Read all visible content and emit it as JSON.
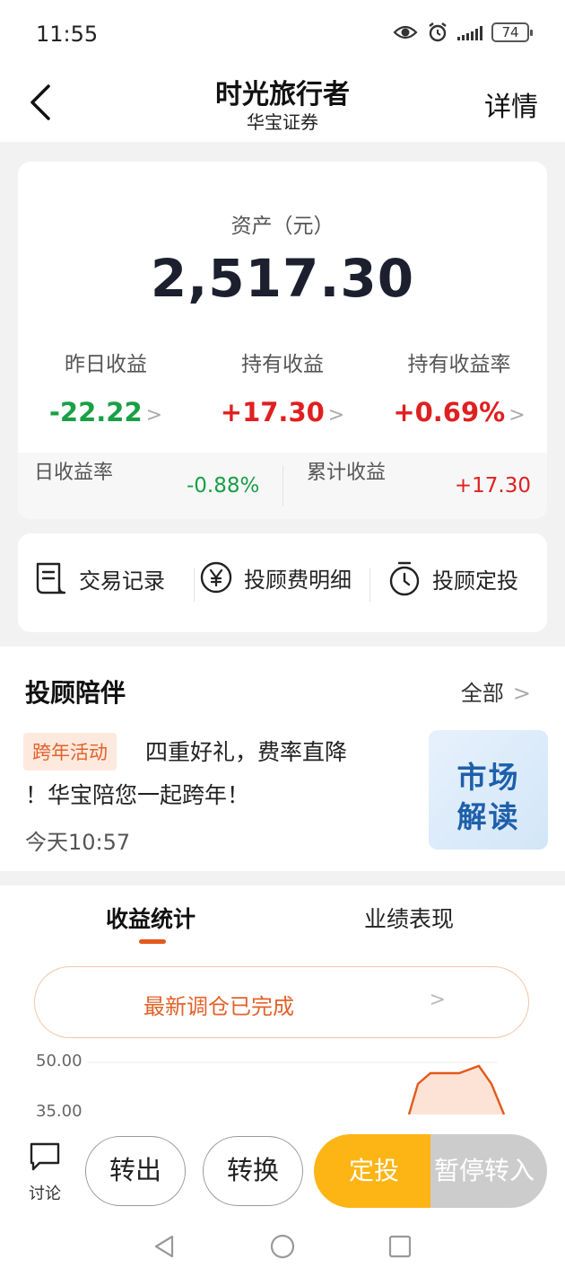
{
  "status_bar": {
    "time": "11:55",
    "battery": "74"
  },
  "nav": {
    "title": "时光旅行者",
    "subtitle": "华宝证券",
    "detail": "详情"
  },
  "asset": {
    "label": "资产（元）",
    "value": "2,517.30",
    "stats": [
      {
        "label": "昨日收益",
        "value": "-22.22",
        "color": "#18a046"
      },
      {
        "label": "持有收益",
        "value": "+17.30",
        "color": "#e02020"
      },
      {
        "label": "持有收益率",
        "value": "+0.69%",
        "color": "#e02020"
      }
    ],
    "daily_rate_label": "日收益率",
    "daily_rate_value": "-0.88%",
    "cumulative_label": "累计收益",
    "cumulative_value": "+17.30"
  },
  "actions": [
    {
      "label": "交易记录",
      "icon": "receipt-icon"
    },
    {
      "label": "投顾费明细",
      "icon": "yen-icon"
    },
    {
      "label": "投顾定投",
      "icon": "timer-icon"
    }
  ],
  "advisor": {
    "title": "投顾陪伴",
    "all": "全部",
    "tag": "跨年活动",
    "text_line1": "四重好礼，费率直降",
    "text_line2": "！华宝陪您一起跨年！",
    "time": "今天10:57",
    "thumb_line1": "市场",
    "thumb_line2": "解读"
  },
  "stats_tabs": {
    "active": "收益统计",
    "other": "业绩表现"
  },
  "notice": "最新调仓已完成",
  "chart_ticks": [
    "50.00",
    "35.00"
  ],
  "bottom": {
    "discuss": "讨论",
    "transfer_out": "转出",
    "convert": "转换",
    "fixed_invest": "定投",
    "pause": "暂停转入"
  },
  "colors": {
    "accent": "#e2622b",
    "up": "#e02020",
    "down": "#18a046",
    "gold": "#fdb515"
  }
}
